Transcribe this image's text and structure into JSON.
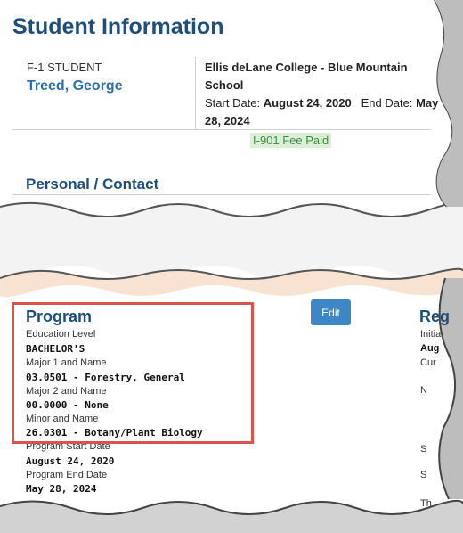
{
  "header": {
    "title": "Student Information",
    "student_type": "F-1 STUDENT",
    "student_name": "Treed, George",
    "school": "Ellis deLane College - Blue Mountain School",
    "start_label": "Start Date:",
    "start_date": "August 24, 2020",
    "end_label": "End Date:",
    "end_date": "May 28, 2024",
    "fee_badge": "I-901 Fee Paid"
  },
  "personal": {
    "title": "Personal / Contact"
  },
  "program": {
    "title": "Program",
    "edit_label": "Edit",
    "fields": [
      {
        "label": "Education Level",
        "value": "BACHELOR'S"
      },
      {
        "label": "Major 1 and Name",
        "value": "03.0501 - Forestry, General"
      },
      {
        "label": "Major 2 and Name",
        "value": "00.0000 - None"
      },
      {
        "label": "Minor and Name",
        "value": "26.0301 - Botany/Plant Biology"
      },
      {
        "label": "Program Start Date",
        "value": "August 24, 2020"
      },
      {
        "label": "Program End Date",
        "value": "May 28, 2024"
      }
    ]
  },
  "registration": {
    "title": "Reg",
    "fragments": [
      "Initia",
      "Aug",
      "Cur",
      "N",
      "S",
      "S",
      "Th"
    ]
  },
  "colors": {
    "heading": "#1f4e79",
    "name": "#2f6fa8",
    "button": "#3f86c6",
    "highlight": "#d9534f",
    "fee_bg": "#dcf0d8",
    "fee_text": "#3c8f3c"
  }
}
